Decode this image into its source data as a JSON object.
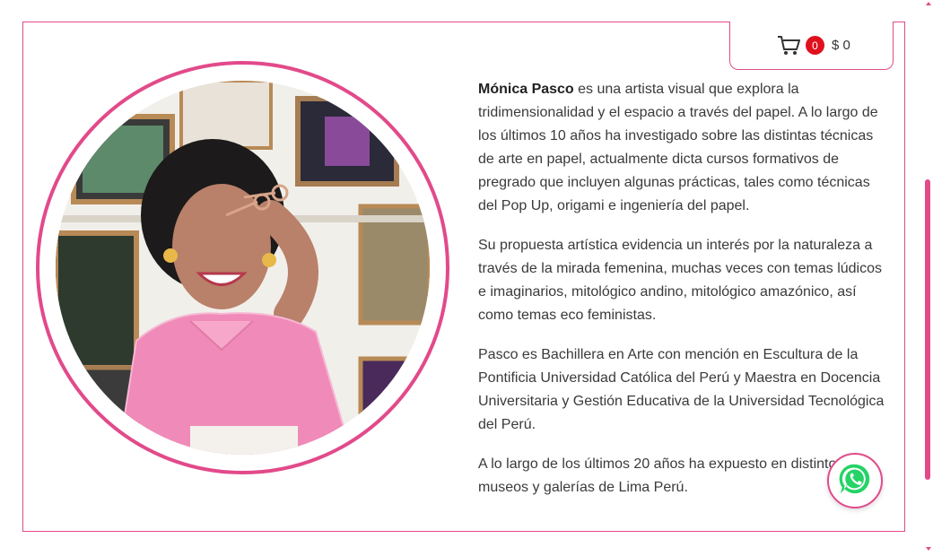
{
  "colors": {
    "accent": "#e24a8a",
    "badge": "#e0101e",
    "whatsapp": "#25d366"
  },
  "cart": {
    "icon": "shopping-cart-icon",
    "count": "0",
    "total": "$ 0"
  },
  "portrait": {
    "icon": "artist-portrait-photo"
  },
  "bio": {
    "name": "Mónica Pasco",
    "p1_rest": " es una artista visual que explora la tridimensionalidad y el espacio a través del papel. A lo largo de los últimos 10 años ha investigado sobre las distintas técnicas de arte en papel, actualmente dicta cursos formativos de pregrado que incluyen algunas prácticas, tales como técnicas del Pop Up, origami e ingeniería del papel.",
    "p2": "Su propuesta artística evidencia un interés por la naturaleza a través de la mirada femenina, muchas veces con temas lúdicos e imaginarios, mitológico andino, mitológico amazónico, así como temas eco feministas.",
    "p3": "Pasco es Bachillera en Arte con mención en Escultura de la Pontificia Universidad Católica del Perú y Maestra en Docencia Universitaria y Gestión Educativa de la Universidad Tecnológica del Perú.",
    "p4": "A lo largo de los últimos 20 años ha expuesto en distintos museos y galerías de Lima Perú."
  },
  "whatsapp": {
    "icon": "whatsapp-icon"
  }
}
